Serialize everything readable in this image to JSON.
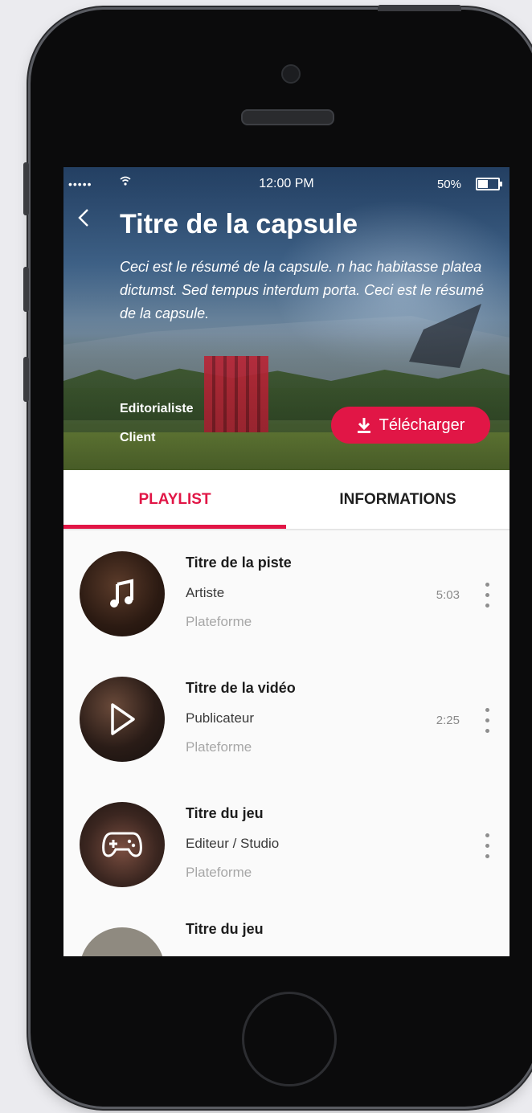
{
  "status_bar": {
    "signal": "•••••",
    "time": "12:00 PM",
    "battery": "50%",
    "battery_level": 0.5
  },
  "header": {
    "title": "Titre de la capsule",
    "summary": "Ceci est le résumé de la capsule. n hac habitasse platea dictumst. Sed tempus interdum porta. Ceci est le résumé de la capsule.",
    "editorialist": "Editorialiste",
    "client": "Client",
    "download_label": "Télécharger"
  },
  "tabs": [
    {
      "label": "PLAYLIST",
      "active": true
    },
    {
      "label": "INFORMATIONS",
      "active": false
    }
  ],
  "playlist": [
    {
      "title": "Titre de la piste",
      "subtitle": "Artiste",
      "platform": "Plateforme",
      "duration": "5:03",
      "icon": "music-note-icon"
    },
    {
      "title": "Titre de la vidéo",
      "subtitle": "Publicateur",
      "platform": "Plateforme",
      "duration": "2:25",
      "icon": "play-icon"
    },
    {
      "title": "Titre du jeu",
      "subtitle": "Editeur / Studio",
      "platform": "Plateforme",
      "duration": "",
      "icon": "gamepad-icon"
    },
    {
      "title": "Titre du jeu",
      "subtitle": "",
      "platform": "",
      "duration": "",
      "icon": ""
    }
  ],
  "colors": {
    "accent": "#e11646",
    "phone_body": "#0b0b0c"
  }
}
